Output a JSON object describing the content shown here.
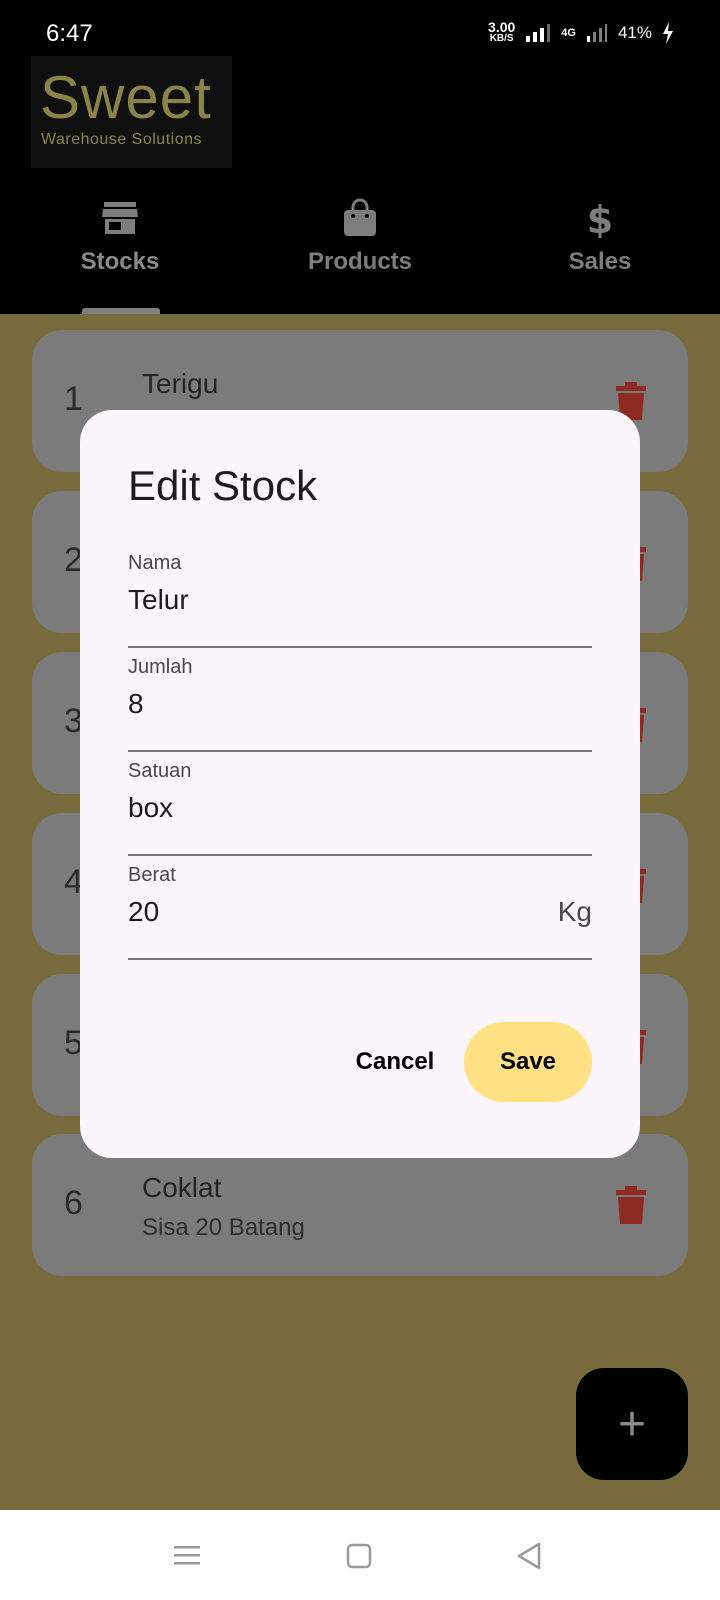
{
  "status_bar": {
    "time": "6:47",
    "net_speed_value": "3.00",
    "net_speed_unit": "KB/S",
    "network_type": "4G",
    "battery": "41%"
  },
  "logo": {
    "main": "Sweet",
    "sub": "Warehouse Solutions"
  },
  "tabs": [
    {
      "label": "Stocks",
      "icon": "store-icon",
      "active": true
    },
    {
      "label": "Products",
      "icon": "shopping-bag-icon",
      "active": false
    },
    {
      "label": "Sales",
      "icon": "dollar-icon",
      "active": false
    }
  ],
  "stock_list": [
    {
      "number": "1",
      "name": "Terigu",
      "detail": ""
    },
    {
      "number": "2",
      "name": "",
      "detail": ""
    },
    {
      "number": "3",
      "name": "",
      "detail": ""
    },
    {
      "number": "4",
      "name": "",
      "detail": ""
    },
    {
      "number": "5",
      "name": "",
      "detail": ""
    },
    {
      "number": "6",
      "name": "Coklat",
      "detail": "Sisa 20 Batang"
    }
  ],
  "dialog": {
    "title": "Edit Stock",
    "fields": [
      {
        "label": "Nama",
        "value": "Telur"
      },
      {
        "label": "Jumlah",
        "value": "8"
      },
      {
        "label": "Satuan",
        "value": "box"
      },
      {
        "label": "Berat",
        "value": "20",
        "suffix": "Kg"
      }
    ],
    "cancel_label": "Cancel",
    "save_label": "Save"
  },
  "fab": {
    "label": "+"
  },
  "colors": {
    "accent_yellow": "#ffe082",
    "content_bg": "#776a3c",
    "logo_gold": "#8c8447",
    "trash_red": "#b3261e"
  }
}
